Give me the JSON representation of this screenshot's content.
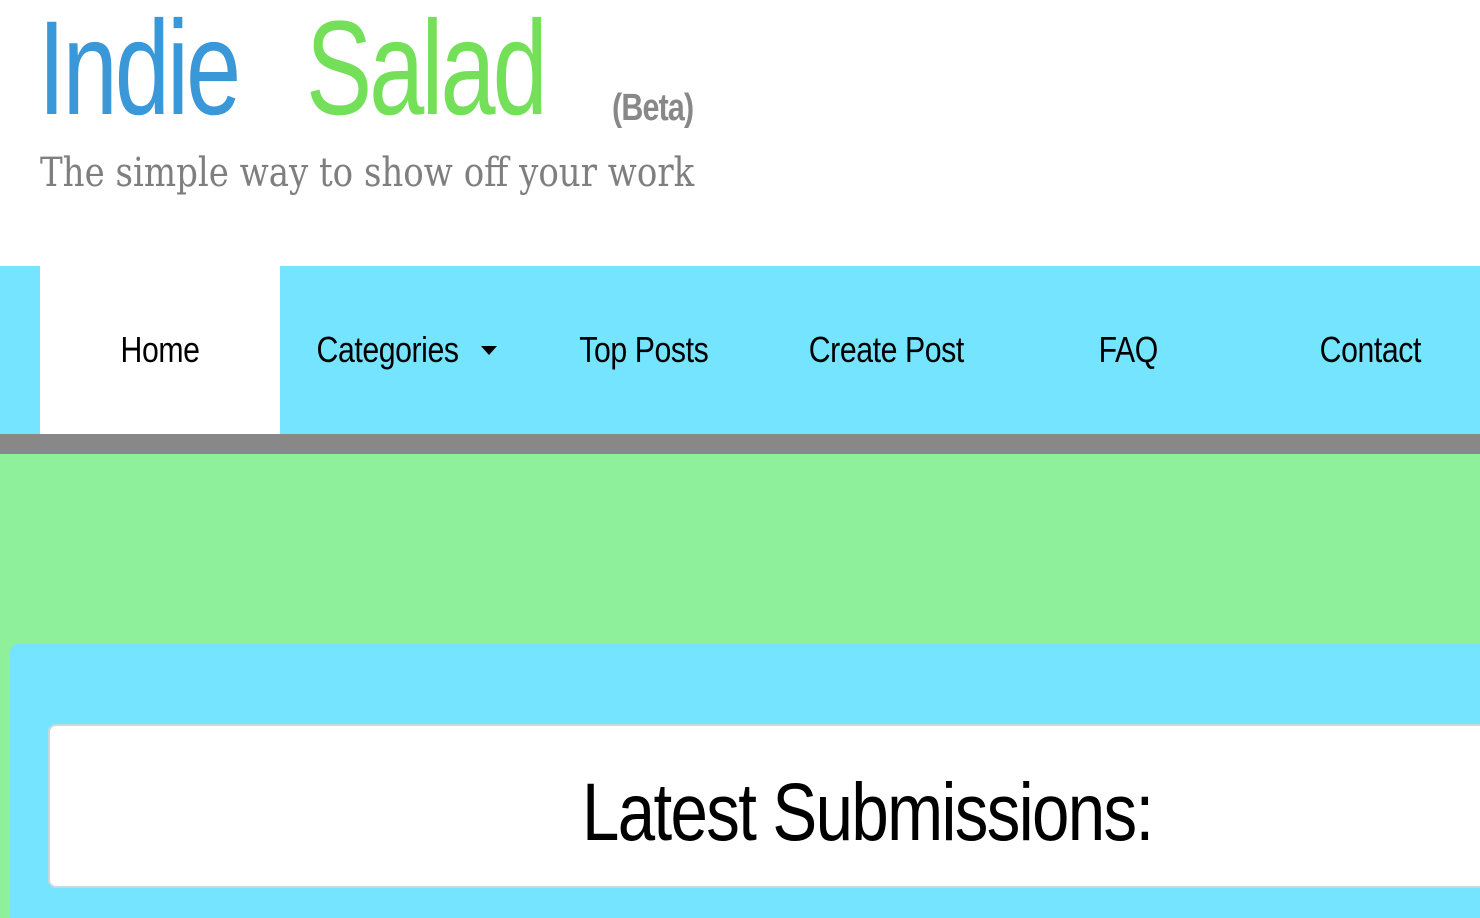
{
  "colors": {
    "brand_blue": "#3a98d8",
    "brand_green": "#74e05a",
    "nav_background": "#75e4ff",
    "divider_gray": "#888888",
    "page_green": "#8ff09c",
    "panel_background": "#75e4ff"
  },
  "header": {
    "logo_word_1": "Indie",
    "logo_word_2": "Salad",
    "logo_badge": "(Beta)",
    "tagline": "The simple way to show off your work"
  },
  "nav": {
    "items": [
      {
        "label": "Home",
        "active": true
      },
      {
        "label": "Categories",
        "has_dropdown": true,
        "icon": "caret-down-icon"
      },
      {
        "label": "Top Posts"
      },
      {
        "label": "Create Post"
      },
      {
        "label": "FAQ"
      },
      {
        "label": "Contact"
      }
    ]
  },
  "main": {
    "section_title": "Latest Submissions:"
  }
}
